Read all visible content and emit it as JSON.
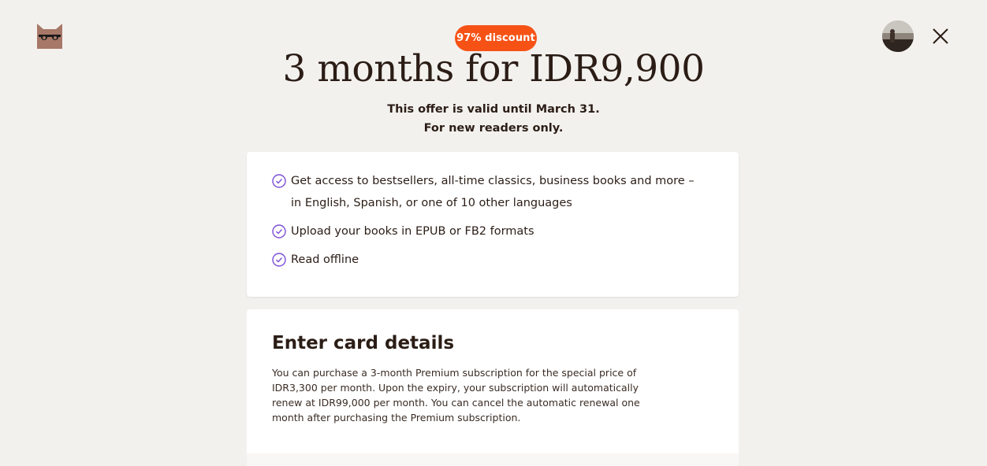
{
  "header": {
    "logo_icon": "bookmate-mask-logo",
    "avatar_icon": "user-avatar",
    "close_icon": "close-x"
  },
  "promo": {
    "badge": "97% discount",
    "headline": "3 months for IDR9,900",
    "valid_until": "This offer is valid until March 31.",
    "eligibility": "For new readers only.",
    "badge_color": "#f65216"
  },
  "features": {
    "check_color": "#7b4fd6",
    "items": [
      "Get access to bestsellers, all-time classics, business books and more – in English, Spanish, or one of 10 other languages",
      "Upload your books in EPUB or FB2 formats",
      "Read offline"
    ]
  },
  "card_details": {
    "title": "Enter card details",
    "description": "You can purchase a 3-month Premium subscription for the special price of IDR3,300 per month. Upon the expiry, your subscription will automatically renew at IDR99,000 per month. You can cancel the automatic renewal one month after purchasing the Premium subscription."
  }
}
